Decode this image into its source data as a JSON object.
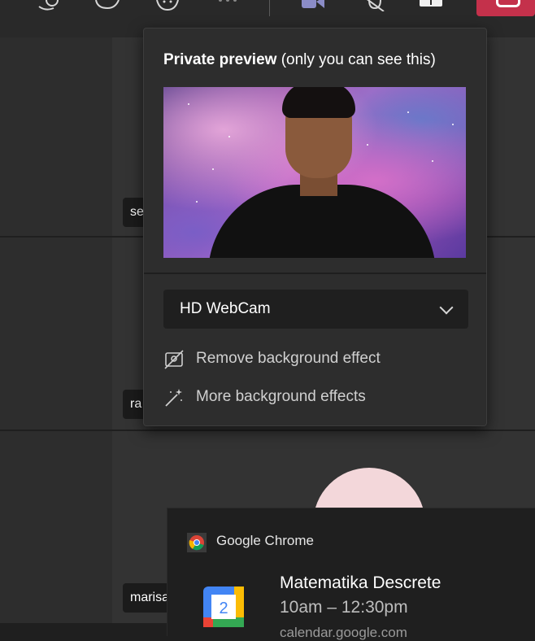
{
  "toolbar": {
    "icons": [
      "people-icon",
      "chat-icon",
      "reactions-icon",
      "more-icon",
      "camera-icon",
      "mic-icon",
      "share-icon",
      "leave-icon"
    ]
  },
  "participants": [
    {
      "name": "se"
    },
    {
      "name": "ra"
    },
    {
      "name": "marisa"
    }
  ],
  "flyout": {
    "title_bold": "Private preview",
    "title_rest": " (only you can see this)",
    "device": "HD WebCam",
    "menu_items": [
      {
        "label": "Remove background effect",
        "icon": "no-background-icon"
      },
      {
        "label": "More background effects",
        "icon": "magic-wand-icon"
      }
    ]
  },
  "notification": {
    "app_name": "Google Chrome",
    "title": "Matematika Descrete",
    "time": "10am – 12:30pm",
    "source": "calendar.google.com",
    "calendar_day": "2"
  },
  "colors": {
    "leave": "#c4314b",
    "panel": "#2d2d2d",
    "background": "#1f1f1f"
  }
}
